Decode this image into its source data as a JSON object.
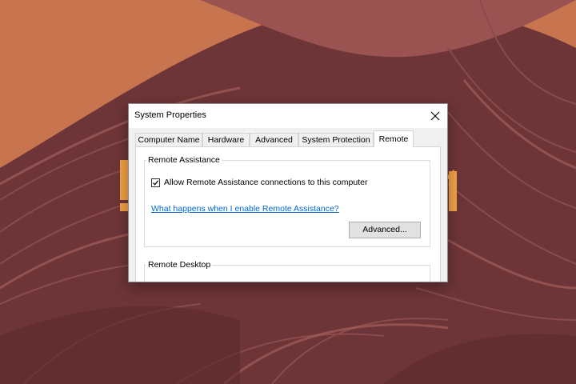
{
  "window": {
    "title": "System Properties"
  },
  "tabs": [
    {
      "label": "Computer Name",
      "active": false
    },
    {
      "label": "Hardware",
      "active": false
    },
    {
      "label": "Advanced",
      "active": false
    },
    {
      "label": "System Protection",
      "active": false
    },
    {
      "label": "Remote",
      "active": true
    }
  ],
  "remote_assistance": {
    "group_label": "Remote Assistance",
    "checkbox_label": "Allow Remote Assistance connections to this computer",
    "checked": true,
    "help_link": "What happens when I enable Remote Assistance?",
    "advanced_button": "Advanced..."
  },
  "remote_desktop": {
    "group_label": "Remote Desktop"
  },
  "colors": {
    "wallpaper_base": "#c7744f",
    "wallpaper_ribbon": "#6e3538",
    "link": "#0066cc"
  },
  "icons": {
    "close": "close-icon",
    "checkmark": "checkmark-icon"
  }
}
